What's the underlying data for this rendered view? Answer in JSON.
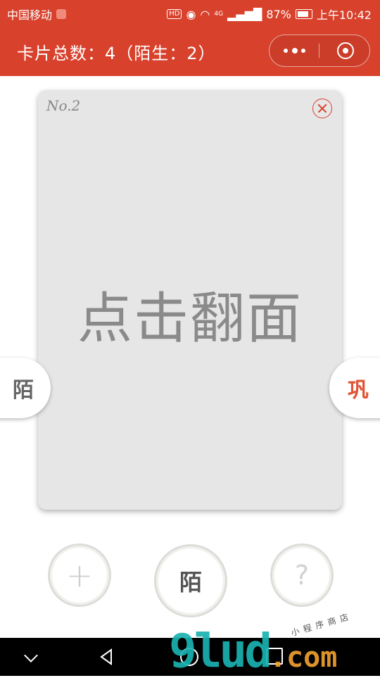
{
  "status_bar": {
    "carrier": "中国移动",
    "hd": "HD",
    "network": "4G",
    "battery": "87%",
    "time": "上午10:42"
  },
  "nav": {
    "title": "卡片总数：4（陌生：2）"
  },
  "card": {
    "number": "No.2",
    "prompt": "点击翻面"
  },
  "side": {
    "left_label": "陌",
    "right_label": "巩"
  },
  "actions": {
    "add": "+",
    "middle": "陌",
    "help": "?"
  },
  "watermark": {
    "main": "9lud",
    "suffix": ".com",
    "small": "小程序商店"
  },
  "colors": {
    "brand": "#d8412c",
    "card_bg": "#e6e6e6",
    "accent_right": "#e05535"
  }
}
